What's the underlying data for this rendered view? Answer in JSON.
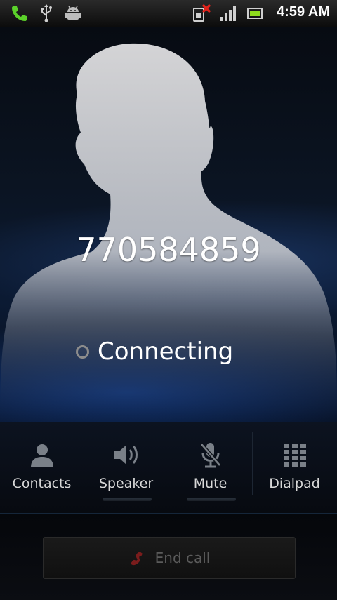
{
  "status_bar": {
    "time": "4:59 AM",
    "icons": [
      "phone-call-icon",
      "usb-icon",
      "android-debug-icon",
      "no-sim-icon",
      "signal-icon",
      "battery-icon"
    ]
  },
  "call": {
    "number": "770584859",
    "status": "Connecting"
  },
  "controls": [
    {
      "label": "Contacts",
      "icon": "contacts-icon"
    },
    {
      "label": "Speaker",
      "icon": "speaker-icon"
    },
    {
      "label": "Mute",
      "icon": "mute-icon"
    },
    {
      "label": "Dialpad",
      "icon": "dialpad-icon"
    }
  ],
  "end_call": {
    "label": "End call",
    "icon": "end-call-icon"
  },
  "colors": {
    "accent_blue": "#1e5ac8",
    "phone_green": "#5bd12a",
    "end_red": "#8b1a1a"
  }
}
